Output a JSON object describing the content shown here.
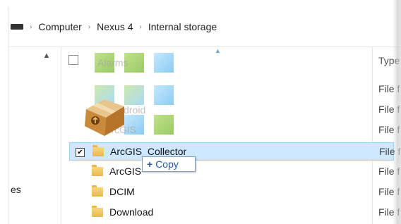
{
  "breadcrumb": {
    "items": [
      "Computer",
      "Nexus 4",
      "Internal storage"
    ],
    "separator": "›"
  },
  "navpane": {
    "partial_label": "es"
  },
  "columns": {
    "type_header": "Type"
  },
  "ghost_rows": [
    {
      "label": "Alarms",
      "type": "File f"
    },
    {
      "label": "Android",
      "type": "File f"
    },
    {
      "label": "ArcGIS",
      "type": "File f"
    }
  ],
  "rows": [
    {
      "name": "ArcGIS_Collector",
      "type": "File f",
      "selected": true,
      "checked": true
    },
    {
      "name": "ArcGIS",
      "type": "File f",
      "selected": false,
      "checked": false
    },
    {
      "name": "DCIM",
      "type": "File f",
      "selected": false,
      "checked": false
    },
    {
      "name": "Download",
      "type": "File f",
      "selected": false,
      "checked": false
    }
  ],
  "drag": {
    "tooltip_text": "Copy",
    "tooltip_icon": "plus-icon"
  },
  "colors": {
    "selection_bg": "#cde8ff",
    "selection_border": "#99d1ff",
    "folder": "#e8b94a",
    "link_blue": "#2459a8"
  }
}
